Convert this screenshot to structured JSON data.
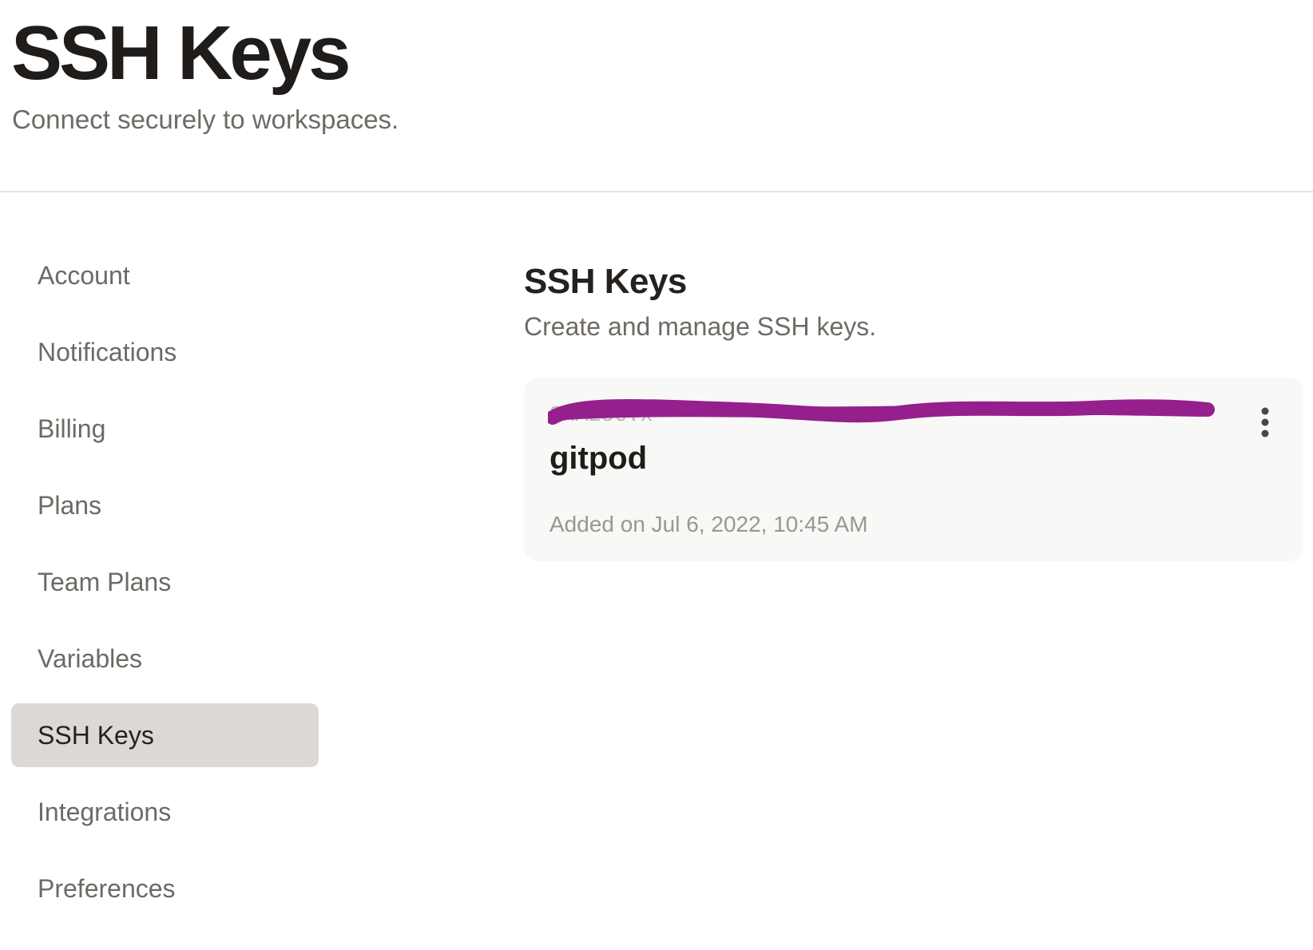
{
  "header": {
    "title": "SSH Keys",
    "subtitle": "Connect securely to workspaces."
  },
  "sidebar": {
    "items": [
      {
        "label": "Account",
        "active": false
      },
      {
        "label": "Notifications",
        "active": false
      },
      {
        "label": "Billing",
        "active": false
      },
      {
        "label": "Plans",
        "active": false
      },
      {
        "label": "Team Plans",
        "active": false
      },
      {
        "label": "Variables",
        "active": false
      },
      {
        "label": "SSH Keys",
        "active": true
      },
      {
        "label": "Integrations",
        "active": false
      },
      {
        "label": "Preferences",
        "active": false
      }
    ]
  },
  "main": {
    "title": "SSH Keys",
    "subtitle": "Create and manage SSH keys.",
    "keys": [
      {
        "fingerprint": "SHA256:x",
        "name": "gitpod",
        "added": "Added on Jul 6, 2022, 10:45 AM",
        "menu_icon": "more-vertical-icon"
      }
    ]
  },
  "colors": {
    "active_item_bg": "#dcd8d5",
    "card_bg": "#f8f8f7",
    "redaction": "#951f8c",
    "divider": "#e4e2df"
  }
}
